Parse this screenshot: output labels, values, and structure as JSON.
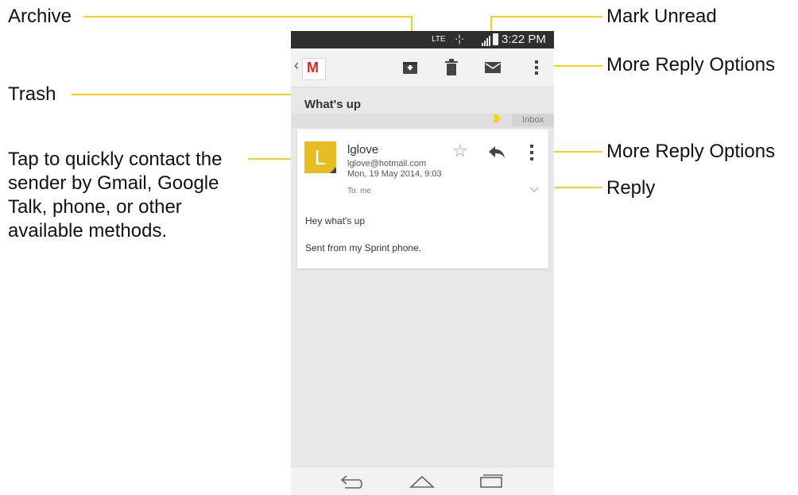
{
  "callouts": {
    "archive": "Archive",
    "mark_unread": "Mark Unread",
    "more_reply_options_top": "More Reply Options",
    "trash": "Trash",
    "more_reply_options_card": "More Reply Options",
    "reply": "Reply",
    "contact": "Tap to quickly contact the sender by Gmail, Google Talk, phone, or other available methods."
  },
  "status_bar": {
    "network": "LTE",
    "time": "3:22 PM"
  },
  "app_bar": {
    "logo": "M"
  },
  "thread": {
    "subject": "What's up",
    "label": "Inbox"
  },
  "message": {
    "avatar_letter": "L",
    "sender": "lglove",
    "email": "lglove@hotmail.com",
    "date": "Mon, 19 May 2014, 9:03",
    "to": "To: me",
    "body_line1": "Hey what's up",
    "body_line2": "Sent from my Sprint phone."
  },
  "icons": {
    "archive": "archive-icon",
    "trash": "trash-icon",
    "mark_unread": "mail-icon",
    "more": "more-vert-icon",
    "star": "star-icon",
    "reply": "reply-icon",
    "back": "back-icon",
    "home": "home-icon",
    "recents": "recents-icon"
  },
  "colors": {
    "leader": "#f4d11e",
    "avatar": "#e7bd24",
    "gmail_red": "#d6281f",
    "label_marker": "#f4d11e"
  }
}
